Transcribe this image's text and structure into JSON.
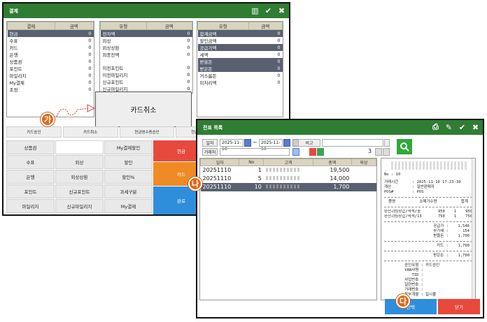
{
  "win1": {
    "title": "결제",
    "icons": [
      "grid-icon",
      "check-icon",
      "close-icon"
    ],
    "table1": {
      "headers": [
        "결제",
        "금액"
      ],
      "rows": [
        {
          "label": "현금",
          "value": "0",
          "dark": true
        },
        {
          "label": "수표",
          "value": "0"
        },
        {
          "label": "카드",
          "value": "0"
        },
        {
          "label": "은행",
          "value": "0"
        },
        {
          "label": "상품권",
          "value": "0"
        },
        {
          "label": "포인트",
          "value": "0"
        },
        {
          "label": "마일리지",
          "value": "0"
        },
        {
          "label": "My결제",
          "value": "0"
        },
        {
          "label": "조정",
          "value": "0"
        }
      ]
    },
    "table2": {
      "headers": [
        "유형",
        "금액"
      ],
      "rows": [
        {
          "label": "전자액",
          "value": "0",
          "dark": true
        },
        {
          "label": "외상",
          "value": "0"
        },
        {
          "label": "외상상환",
          "value": "0"
        },
        {
          "label": "최종잔액",
          "value": "0"
        },
        {
          "label": "",
          "value": ""
        },
        {
          "label": "이전포인트",
          "value": "0"
        },
        {
          "label": "이전마일리지",
          "value": "0"
        },
        {
          "label": "신규포인트",
          "value": "0"
        },
        {
          "label": "신규마일리지",
          "value": "0"
        },
        {
          "label": "누적포인트",
          "value": "0"
        }
      ]
    },
    "table3": {
      "headers": [
        "유형",
        "금액"
      ],
      "rows": [
        {
          "label": "합계금액",
          "value": "0",
          "dark": true
        },
        {
          "label": "할인금액",
          "value": "0"
        },
        {
          "label": "공급가액",
          "value": "0",
          "dark": true
        },
        {
          "label": "세액",
          "value": "0"
        },
        {
          "label": "받을돈",
          "value": "0",
          "dark": true
        },
        {
          "label": "받은돈",
          "value": "0",
          "dark": true
        },
        {
          "label": "거스름돈",
          "value": "0"
        },
        {
          "label": "미처리액",
          "value": "0"
        }
      ]
    },
    "callout": "카드취소",
    "tab_row": [
      "카드승인",
      "카드취소",
      "현금영수증승인",
      "현금영수증취소",
      "수표조회"
    ],
    "grid": [
      {
        "label": "상품권",
        "style": ""
      },
      {
        "label": "",
        "style": "white"
      },
      {
        "label": "My결제할인",
        "style": ""
      },
      {
        "label": "수표",
        "style": ""
      },
      {
        "label": "외상",
        "style": ""
      },
      {
        "label": "할인",
        "style": ""
      },
      {
        "label": "은행",
        "style": ""
      },
      {
        "label": "외상상환",
        "style": ""
      },
      {
        "label": "할인%",
        "style": ""
      },
      {
        "label": "포인트",
        "style": ""
      },
      {
        "label": "신규포인트",
        "style": ""
      },
      {
        "label": "과세구분",
        "style": ""
      },
      {
        "label": "마일리지",
        "style": ""
      },
      {
        "label": "신규마일리지",
        "style": ""
      },
      {
        "label": "My결제",
        "style": ""
      }
    ],
    "side": {
      "cash": "현금",
      "card": "카드",
      "done": "완료"
    }
  },
  "markers": {
    "ga": "가",
    "na": "나",
    "da": "다"
  },
  "win2": {
    "title": "전표 목록",
    "icons": [
      "print-icon",
      "edit-icon",
      "check-icon",
      "close-icon"
    ],
    "filter": {
      "date_label": "일자",
      "date_from": "2025-11-10",
      "tilde": "~",
      "date_to": "2025-11-10",
      "customer_label": "거래처",
      "bigo_label": "비고",
      "count": "3"
    },
    "list": {
      "headers": [
        "일자",
        "No",
        "고객",
        "총액",
        "외상"
      ],
      "rows": [
        {
          "date": "20251110",
          "no": "1",
          "cust": "",
          "total": "19,500",
          "credit": ""
        },
        {
          "date": "20251110",
          "no": "5",
          "cust": "",
          "total": "14,000",
          "credit": ""
        },
        {
          "date": "20251110",
          "no": "10",
          "cust": "",
          "total": "1,700",
          "credit": "",
          "selected": true
        }
      ]
    },
    "receipt": {
      "no": "No : 10",
      "datetime_label": "거래시간",
      "datetime": ": 2025-11-10 17:23:39",
      "counter_label": "계산",
      "counter": ": 일반판매자",
      "pos_label": "POS#",
      "pos": ": POS",
      "cols": [
        "품명",
        "소매가수량",
        "합계"
      ],
      "items": [
        {
          "name": "완전괴링장갑/적색/중",
          "price": "950",
          "qty": "1",
          "sum": "950"
        },
        {
          "name": "완전괴링장갑/적색/13",
          "price": "750",
          "qty": "1",
          "sum": "750"
        }
      ],
      "supply_label": "공급가 :",
      "supply": "1,546",
      "tax_label": "부가세 :",
      "tax": "154",
      "recv_label": "받을돈 :",
      "recv": "1,700",
      "card_label": "카드 :",
      "card": "1,700",
      "got_label": "받은돈 :",
      "got": "1,700",
      "approval_type_label": "승인유형 :",
      "approval_type": "카드승인",
      "van_label": "VAN사명 :",
      "tid_label": "TID :",
      "biz_label": "사업번호 :",
      "batch_label": "일련번호 :",
      "deal_label": "거래번호 :",
      "inst_label": "할부개월 :",
      "inst": "일시불"
    },
    "select_btn": "선택",
    "close_btn": "닫기"
  }
}
